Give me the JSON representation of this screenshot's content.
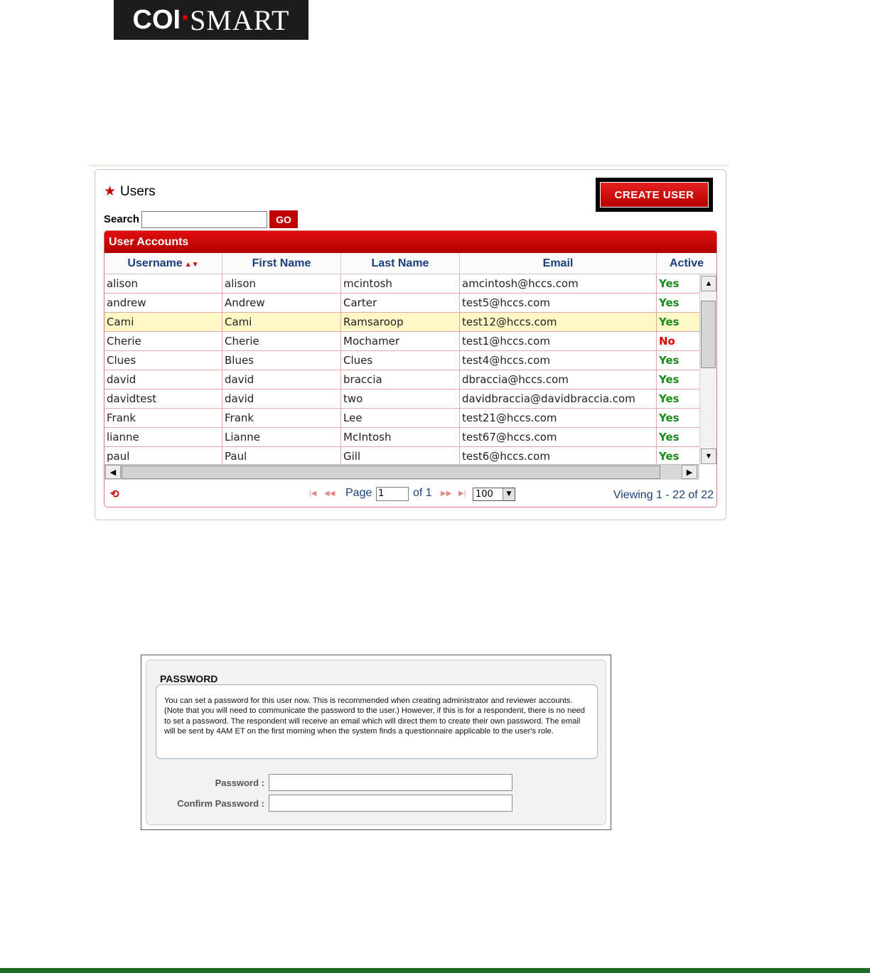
{
  "logo": {
    "text_left": "COI",
    "text_right": "SMART"
  },
  "users_panel": {
    "title": "Users",
    "create_button": "CREATE USER",
    "search": {
      "label": "Search",
      "value": "",
      "go_label": "GO"
    },
    "grid": {
      "caption": "User Accounts",
      "columns": [
        "Username",
        "First Name",
        "Last Name",
        "Email",
        "Active"
      ],
      "rows": [
        [
          "alison",
          "alison",
          "mcintosh",
          "amcintosh@hccs.com",
          "Yes"
        ],
        [
          "andrew",
          "Andrew",
          "Carter",
          "test5@hccs.com",
          "Yes"
        ],
        [
          "Cami",
          "Cami",
          "Ramsaroop",
          "test12@hccs.com",
          "Yes"
        ],
        [
          "Cherie",
          "Cherie",
          "Mochamer",
          "test1@hccs.com",
          "No"
        ],
        [
          "Clues",
          "Blues",
          "Clues",
          "test4@hccs.com",
          "Yes"
        ],
        [
          "david",
          "david",
          "braccia",
          "dbraccia@hccs.com",
          "Yes"
        ],
        [
          "davidtest",
          "david",
          "two",
          "davidbraccia@davidbraccia.com",
          "Yes"
        ],
        [
          "Frank",
          "Frank",
          "Lee",
          "test21@hccs.com",
          "Yes"
        ],
        [
          "lianne",
          "Lianne",
          "McIntosh",
          "test67@hccs.com",
          "Yes"
        ],
        [
          "paul",
          "Paul",
          "Gill",
          "test6@hccs.com",
          "Yes"
        ]
      ],
      "selected_row_index": 2
    },
    "pager": {
      "page_label": "Page",
      "page_value": "1",
      "of_label": "of 1",
      "rows_per_page": "100",
      "viewing": "Viewing 1 - 22 of 22"
    }
  },
  "password_panel": {
    "title": "PASSWORD",
    "note": "You can set a password for this user now. This is recommended when creating administrator and reviewer accounts. (Note that you will need to communicate the password to the user.) However, if this is for a respondent, there is no need to set a password. The respondent will receive an email which will direct them to create their own password. The email will be sent by 4AM ET on the first morning when the system finds a questionnaire applicable to the user's role.",
    "password_label": "Password :",
    "confirm_label": "Confirm Password :"
  },
  "colors": {
    "brand_red": "#c00000",
    "active_yes": "#1b8a1b",
    "active_no": "#dd0000",
    "header_text": "#1a3f7a",
    "selected_row": "#fdf8c6",
    "footer_bar": "#1e6b23"
  }
}
